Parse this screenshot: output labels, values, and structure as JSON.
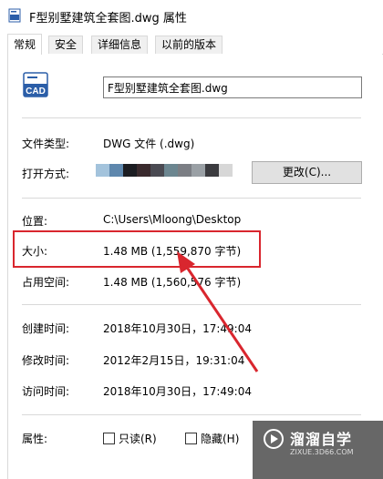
{
  "window": {
    "title": "F型别墅建筑全套图.dwg 属性"
  },
  "tabs": [
    {
      "label": "常规",
      "active": true
    },
    {
      "label": "安全",
      "active": false
    },
    {
      "label": "详细信息",
      "active": false
    },
    {
      "label": "以前的版本",
      "active": false
    }
  ],
  "file": {
    "icon_text": "CAD",
    "name": "F型别墅建筑全套图.dwg"
  },
  "properties": {
    "type_label": "文件类型:",
    "type_value": "DWG 文件 (.dwg)",
    "open_label": "打开方式:",
    "change_button": "更改(C)...",
    "location_label": "位置:",
    "location_value": "C:\\Users\\Mloong\\Desktop",
    "size_label": "大小:",
    "size_value": "1.48 MB (1,559,870 字节)",
    "disk_label": "占用空间:",
    "disk_value": "1.48 MB (1,560,576 字节)",
    "created_label": "创建时间:",
    "created_value": "2018年10月30日，17:49:04",
    "modified_label": "修改时间:",
    "modified_value": "2012年2月15日，19:31:04",
    "accessed_label": "访问时间:",
    "accessed_value": "2018年10月30日，17:49:04",
    "attributes_label": "属性:",
    "readonly_label": "只读(R)",
    "hidden_label": "隐藏(H)"
  },
  "watermark": {
    "title": "溜溜自学",
    "subtitle": "ZIXUE.3D66.COM"
  },
  "colors": {
    "highlight_border": "#d9262e",
    "cad_icon": "#2b5ea8",
    "open_with_pixels": [
      "#a3c3dc",
      "#5e87ad",
      "#1c1d22",
      "#3a2a2d",
      "#4a4a52",
      "#6c8690",
      "#7b7e84",
      "#9aa0a5",
      "#3b3b3f",
      "#d7d7d7"
    ]
  }
}
